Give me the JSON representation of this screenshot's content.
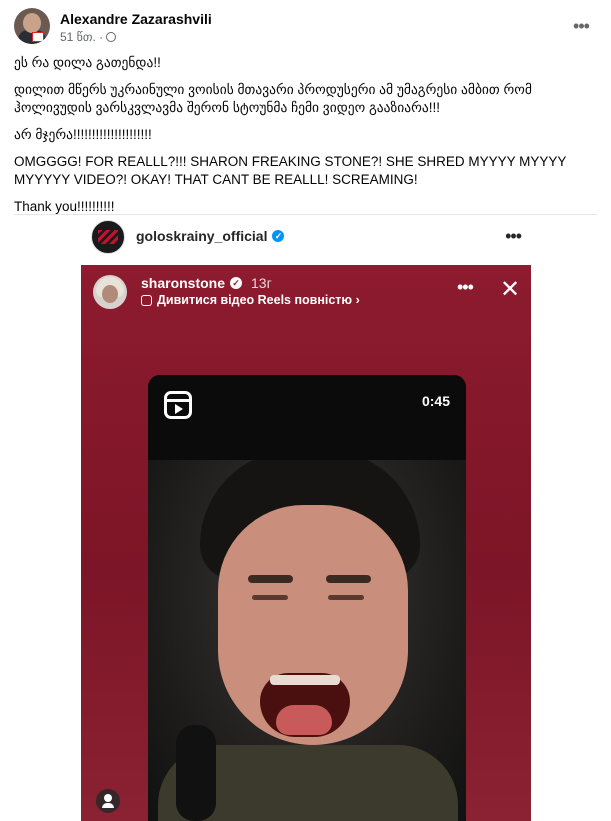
{
  "post": {
    "author": "Alexandre Zazarashvili",
    "time": "51 წთ. ·",
    "paragraphs": [
      "ეს რა დილა გათენდა!!",
      "დილით მწერს უკრაინული ვოისის მთავარი პროდუსერი ამ უმაგრესი ამბით რომ ჰოლივუდის ვარსკვლავმა შერონ სტოუნმა ჩემი ვიდეო გააზიარა!!!",
      "არ მჯერა!!!!!!!!!!!!!!!!!!!!!",
      "OMGGGG! FOR REALLL?!!! SHARON FREAKING STONE?! SHE SHRED MYYYY MYYYY MYYYYY VIDEO?! OKAY! THAT CANT BE REALLL! SCREAMING!",
      "Thank you!!!!!!!!!!"
    ]
  },
  "shared": {
    "account": "goloskrainy_official"
  },
  "story": {
    "username": "sharonstone",
    "time": "13г",
    "reels_link": "Дивитися відео Reels повністю ›",
    "duration": "0:45"
  },
  "icons": {
    "more": "more-horizontal-icon",
    "globe": "globe-icon",
    "verified": "verified-badge-icon",
    "close": "close-icon",
    "reels": "reels-icon",
    "user": "user-icon"
  },
  "colors": {
    "story_bg": "#8e1b2f",
    "verified_blue": "#0095f6",
    "meta_gray": "#65676b"
  }
}
